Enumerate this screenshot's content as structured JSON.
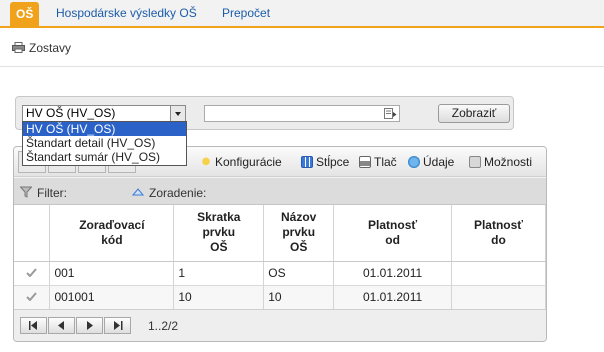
{
  "tabs": [
    {
      "label": "OŠ",
      "active": true
    },
    {
      "label": "Hospodárske výsledky OŠ",
      "active": false
    },
    {
      "label": "Prepočet",
      "active": false
    }
  ],
  "toolbar": {
    "reports_label": "Zostavy"
  },
  "filter": {
    "select_value": "HV OŠ (HV_OS)",
    "text_value": "",
    "show_button": "Zobraziť",
    "options": [
      "HV OŠ (HV_OS)",
      "Štandart detail (HV_OS)",
      "Štandart sumár (HV_OS)"
    ]
  },
  "grid_toolbar": {
    "config": "Konfigurácie",
    "columns": "Stĺpce",
    "print": "Tlač",
    "data": "Údaje",
    "options": "Možnosti",
    "hidden_partial": "2"
  },
  "filter_row": {
    "filter_label": "Filter:",
    "sort_label": "Zoradenie:"
  },
  "table": {
    "headers": [
      "Zoraďovací\nkód",
      "Skratka\nprvku\nOŠ",
      "Názov\nprvku\nOŠ",
      "Platnosť\nod",
      "Platnosť\ndo"
    ],
    "rows": [
      [
        "001",
        "1",
        "OS",
        "01.01.2011",
        ""
      ],
      [
        "001001",
        "10",
        "10",
        "01.01.2011",
        ""
      ]
    ]
  },
  "pager": {
    "info": "1..2/2"
  },
  "colors": {
    "accent": "#f0a21b",
    "link": "#1c5ca8",
    "selection": "#2a62c8"
  }
}
